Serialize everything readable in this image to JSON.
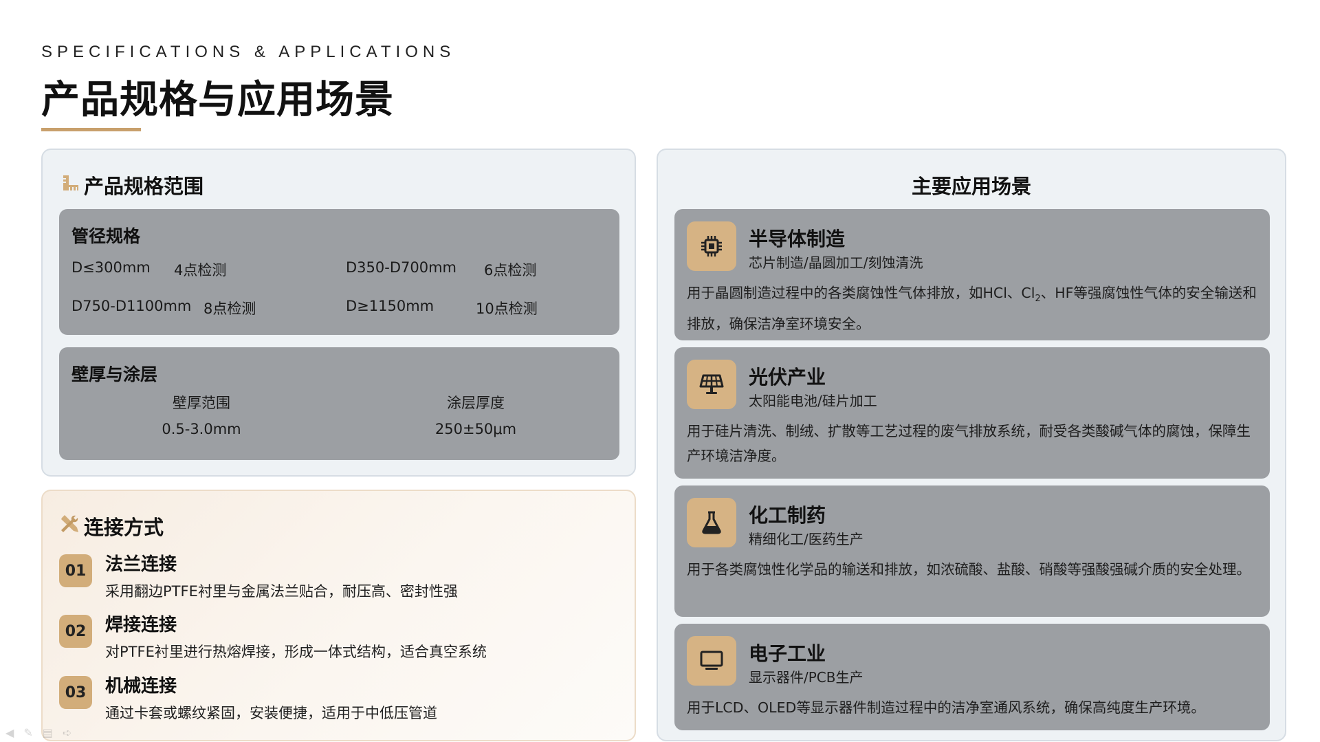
{
  "header": {
    "kicker": "SPECIFICATIONS & APPLICATIONS",
    "title": "产品规格与应用场景"
  },
  "spec_panel": {
    "heading": "产品规格范围",
    "icon": "ruler-icon",
    "pipe": {
      "title": "管径规格",
      "rows": [
        {
          "size": "D≤300mm",
          "points": "4点检测"
        },
        {
          "size": "D350-D700mm",
          "points": "6点检测"
        },
        {
          "size": "D750-D1100mm",
          "points": "8点检测"
        },
        {
          "size": "D≥1150mm",
          "points": "10点检测"
        }
      ]
    },
    "wall": {
      "title": "壁厚与涂层",
      "labels": [
        "壁厚范围",
        "涂层厚度"
      ],
      "values": [
        "0.5-3.0mm",
        "250±50μm"
      ]
    }
  },
  "connection_panel": {
    "heading": "连接方式",
    "icon": "tools-icon",
    "items": [
      {
        "num": "01",
        "title": "法兰连接",
        "desc": "采用翻边PTFE衬里与金属法兰贴合，耐压高、密封性强"
      },
      {
        "num": "02",
        "title": "焊接连接",
        "desc": "对PTFE衬里进行热熔焊接，形成一体式结构，适合真空系统"
      },
      {
        "num": "03",
        "title": "机械连接",
        "desc": "通过卡套或螺纹紧固，安装便捷，适用于中低压管道"
      }
    ]
  },
  "app_panel": {
    "heading": "主要应用场景",
    "items": [
      {
        "icon": "chip-icon",
        "title": "半导体制造",
        "sub": "芯片制造/晶圆加工/刻蚀清洗",
        "desc_a": "用于晶圆制造过程中的各类腐蚀性气体排放，如HCl、Cl",
        "desc_sub": "2",
        "desc_b": "、HF等强腐蚀性气体的安全输送和排放，确保洁净室环境安全。"
      },
      {
        "icon": "solar-panel-icon",
        "title": "光伏产业",
        "sub": "太阳能电池/硅片加工",
        "desc": "用于硅片清洗、制绒、扩散等工艺过程的废气排放系统，耐受各类酸碱气体的腐蚀，保障生产环境洁净度。"
      },
      {
        "icon": "flask-icon",
        "title": "化工制药",
        "sub": "精细化工/医药生产",
        "desc": "用于各类腐蚀性化学品的输送和排放，如浓硫酸、盐酸、硝酸等强酸强碱介质的安全处理。"
      },
      {
        "icon": "monitor-icon",
        "title": "电子工业",
        "sub": "显示器件/PCB生产",
        "desc": "用于LCD、OLED等显示器件制造过程中的洁净室通风系统，确保高纯度生产环境。"
      }
    ]
  },
  "colors": {
    "accent": "#c8a06c",
    "icon_bg": "#d6b384",
    "card_gray": "#9c9fa3",
    "panel_bg": "#eef2f5"
  }
}
